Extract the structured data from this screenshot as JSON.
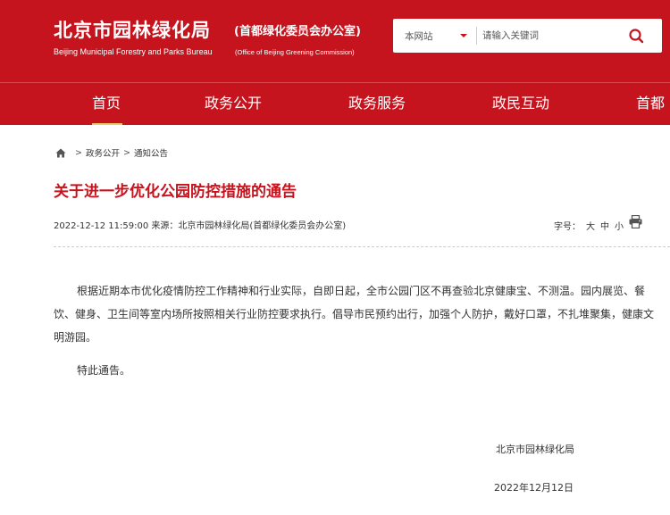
{
  "header": {
    "site_name": "北京市园林绿化局",
    "site_sub": "(首都绿化委员会办公室)",
    "site_name_en": "Beijing Municipal Forestry and Parks Bureau",
    "site_sub_en": "(Office of Beijing Greening Commission)",
    "brand_color": "#c6141e"
  },
  "search": {
    "scope_selected": "本网站",
    "placeholder": "请输入关键词",
    "button_icon": "search-icon"
  },
  "nav": {
    "items": [
      {
        "label": "首页",
        "active": true
      },
      {
        "label": "政务公开",
        "active": false
      },
      {
        "label": "政务服务",
        "active": false
      },
      {
        "label": "政民互动",
        "active": false
      },
      {
        "label": "首都",
        "active": false
      }
    ]
  },
  "breadcrumb": {
    "home_icon": "home-icon",
    "sep": ">",
    "items": [
      "政务公开",
      "通知公告"
    ]
  },
  "article": {
    "title": "关于进一步优化公园防控措施的通告",
    "meta": "2022-12-12 11:59:00 来源：北京市园林绿化局(首都绿化委员会办公室)",
    "font_size_label": "字号：",
    "font_sizes": [
      "大",
      "中",
      "小"
    ],
    "print_icon": "print-icon",
    "body": "根据近期本市优化疫情防控工作精神和行业实际，自即日起，全市公园门区不再查验北京健康宝、不测温。园内展览、餐饮、健身、卫生间等室内场所按照相关行业防控要求执行。倡导市民预约出行，加强个人防护，戴好口罩，不扎堆聚集，健康文明游园。",
    "closing": "特此通告。",
    "signature": "北京市园林绿化局",
    "date": "2022年12月12日"
  }
}
